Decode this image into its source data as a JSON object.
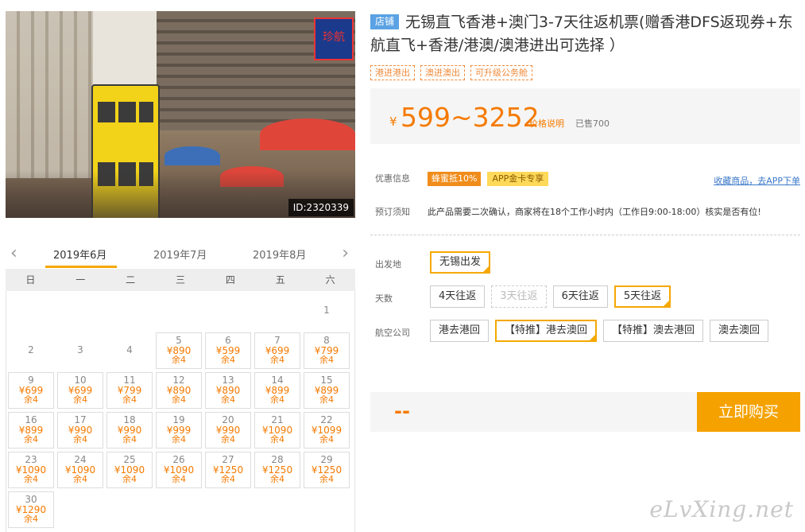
{
  "photo": {
    "id_label": "ID:2320339",
    "sign_text": "珍航"
  },
  "calendar": {
    "months": [
      "2019年6月",
      "2019年7月",
      "2019年8月"
    ],
    "weekdays": [
      "日",
      "一",
      "二",
      "三",
      "四",
      "五",
      "六"
    ],
    "days": [
      {
        "d": "1"
      },
      {
        "d": "2"
      },
      {
        "d": "3"
      },
      {
        "d": "4"
      },
      {
        "d": "5",
        "p": "¥890",
        "r": "余4"
      },
      {
        "d": "6",
        "p": "¥599",
        "r": "余4"
      },
      {
        "d": "7",
        "p": "¥699",
        "r": "余4"
      },
      {
        "d": "8",
        "p": "¥799",
        "r": "余4"
      },
      {
        "d": "9",
        "p": "¥699",
        "r": "余4"
      },
      {
        "d": "10",
        "p": "¥699",
        "r": "余4"
      },
      {
        "d": "11",
        "p": "¥799",
        "r": "余4"
      },
      {
        "d": "12",
        "p": "¥890",
        "r": "余4"
      },
      {
        "d": "13",
        "p": "¥890",
        "r": "余4"
      },
      {
        "d": "14",
        "p": "¥899",
        "r": "余4"
      },
      {
        "d": "15",
        "p": "¥899",
        "r": "余4"
      },
      {
        "d": "16",
        "p": "¥899",
        "r": "余4"
      },
      {
        "d": "17",
        "p": "¥990",
        "r": "余4"
      },
      {
        "d": "18",
        "p": "¥990",
        "r": "余4"
      },
      {
        "d": "19",
        "p": "¥999",
        "r": "余4"
      },
      {
        "d": "20",
        "p": "¥990",
        "r": "余4"
      },
      {
        "d": "21",
        "p": "¥1090",
        "r": "余4"
      },
      {
        "d": "22",
        "p": "¥1099",
        "r": "余4"
      },
      {
        "d": "23",
        "p": "¥1090",
        "r": "余4"
      },
      {
        "d": "24",
        "p": "¥1090",
        "r": "余4"
      },
      {
        "d": "25",
        "p": "¥1090",
        "r": "余4"
      },
      {
        "d": "26",
        "p": "¥1090",
        "r": "余4"
      },
      {
        "d": "27",
        "p": "¥1250",
        "r": "余4"
      },
      {
        "d": "28",
        "p": "¥1250",
        "r": "余4"
      },
      {
        "d": "29",
        "p": "¥1250",
        "r": "余4"
      },
      {
        "d": "30",
        "p": "¥1290",
        "r": "余4"
      }
    ]
  },
  "product": {
    "shop_tag": "店铺",
    "title": "无锡直飞香港+澳门3-7天往返机票(赠香港DFS返现券+东航直飞+香港/港澳/澳港进出可选择 ）",
    "tags": [
      "港进港出",
      "澳进澳出",
      "可升级公务舱"
    ],
    "price": {
      "currency": "¥",
      "range": "599~3252",
      "explain": "价格说明",
      "sold": "已售700"
    },
    "promo": {
      "label": "优惠信息",
      "badge1": "蜂蜜抵10%",
      "badge2": "APP金卡专享",
      "fav_link": "收藏商品，去APP下单"
    },
    "notice": {
      "label": "预订须知",
      "text": "此产品需要二次确认，商家将在18个工作小时内（工作日9:00-18:00）核实是否有位!"
    },
    "options": {
      "departure": {
        "label": "出发地",
        "items": [
          "无锡出发"
        ]
      },
      "days": {
        "label": "天数",
        "items": [
          "4天往返",
          "3天往返",
          "6天往返",
          "5天往返"
        ]
      },
      "airline": {
        "label": "航空公司",
        "items": [
          "港去港回",
          "【特推】港去澳回",
          "【特推】澳去港回",
          "澳去澳回"
        ]
      }
    },
    "buy": {
      "placeholder": "--",
      "button": "立即购买"
    }
  },
  "watermark": "eLvXing.net",
  "colors": {
    "accent": "#f5a800",
    "price": "#f57a00",
    "shop_tag": "#5aa2e3",
    "link": "#3a78c8"
  }
}
